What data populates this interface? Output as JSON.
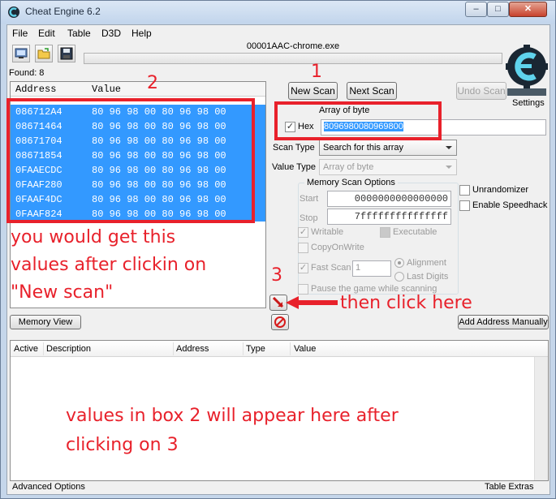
{
  "window": {
    "title": "Cheat Engine 6.2",
    "min_glyph": "–",
    "max_glyph": "□",
    "close_glyph": "✕"
  },
  "menu": [
    "File",
    "Edit",
    "Table",
    "D3D",
    "Help"
  ],
  "toolbar": {
    "icons": [
      "open-process-icon",
      "open-file-icon",
      "save-icon"
    ]
  },
  "process": {
    "name": "00001AAC-chrome.exe",
    "progress": 0
  },
  "found": "Found: 8",
  "logo": {
    "alt": "Cheat Engine"
  },
  "settings_label": "Settings",
  "results": {
    "columns": [
      "Address",
      "Value"
    ],
    "rows": [
      {
        "address": "086712A4",
        "value": "80 96 98 00 80 96 98 00"
      },
      {
        "address": "08671464",
        "value": "80 96 98 00 80 96 98 00"
      },
      {
        "address": "08671704",
        "value": "80 96 98 00 80 96 98 00"
      },
      {
        "address": "08671854",
        "value": "80 96 98 00 80 96 98 00"
      },
      {
        "address": "0FAAECDC",
        "value": "80 96 98 00 80 96 98 00"
      },
      {
        "address": "0FAAF280",
        "value": "80 96 98 00 80 96 98 00"
      },
      {
        "address": "0FAAF4DC",
        "value": "80 96 98 00 80 96 98 00"
      },
      {
        "address": "0FAAF824",
        "value": "80 96 98 00 80 96 98 00"
      }
    ]
  },
  "scan": {
    "new_scan": "New Scan",
    "next_scan": "Next Scan",
    "undo_scan": "Undo Scan",
    "value_type_label": "Array of byte",
    "hex_label": "Hex",
    "hex_checked": true,
    "value_input": "8096980080969800",
    "scan_type_label": "Scan Type",
    "scan_type_value": "Search for this array",
    "value_type_field_label": "Value Type",
    "value_type_value": "Array of byte"
  },
  "memory_options": {
    "title": "Memory Scan Options",
    "start_label": "Start",
    "start_value": "0000000000000000",
    "stop_label": "Stop",
    "stop_value": "7fffffffffffffff",
    "writable": "Writable",
    "executable": "Executable",
    "copy_on_write": "CopyOnWrite",
    "fast_scan": "Fast Scan",
    "fast_scan_value": "1",
    "alignment": "Alignment",
    "last_digits": "Last Digits",
    "pause_game": "Pause the game while scanning"
  },
  "side_options": {
    "unrandomizer": "Unrandomizer",
    "enable_speedhack": "Enable Speedhack"
  },
  "buttons": {
    "memory_view": "Memory View",
    "add_address_manually": "Add Address Manually"
  },
  "address_list": {
    "columns": [
      "Active",
      "Description",
      "Address",
      "Type",
      "Value"
    ]
  },
  "footer": {
    "advanced_options": "Advanced Options",
    "table_extras": "Table Extras"
  },
  "annotations": {
    "n1": "1",
    "n2": "2",
    "n3": "3",
    "note_results": [
      "you would get this",
      "values after clickin on",
      "\"New scan\""
    ],
    "note_click": "then click here",
    "note_list": [
      "values in box 2 will appear here after",
      "clicking on 3"
    ]
  },
  "colors": {
    "annotation": "#e8212b",
    "selection": "#3399ff"
  }
}
